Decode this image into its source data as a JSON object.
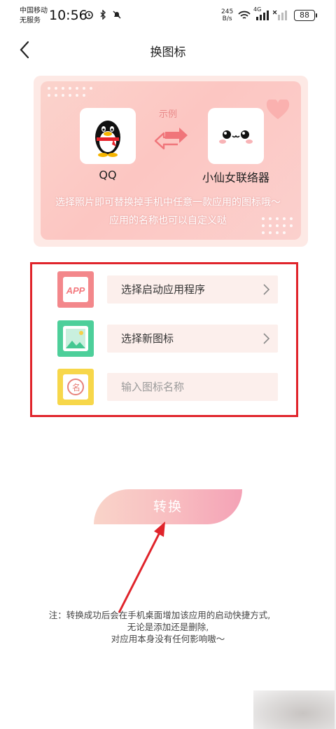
{
  "status_bar": {
    "carrier_1": "中国移动",
    "carrier_2": "无服务",
    "time": "10:56",
    "net_speed_value": "245",
    "net_speed_unit": "B/s",
    "network": "4G",
    "battery": "88"
  },
  "nav": {
    "title": "换图标",
    "back_icon": "chevron-left-icon"
  },
  "banner": {
    "example_label": "示例",
    "source_app_label": "QQ",
    "target_app_label": "小仙女联络器",
    "line_1": "选择照片即可替换掉手机中任意一款应用的图标哦～",
    "line_2": "应用的名称也可以自定义哒",
    "colors": {
      "text": "#ffffff",
      "example": "#e98a8a"
    }
  },
  "form": {
    "rows": [
      {
        "icon": "app-icon",
        "icon_text": "APP",
        "label": "选择启动应用程序",
        "has_chevron": true,
        "icon_color": "#f3878b"
      },
      {
        "icon": "image-icon",
        "label": "选择新图标",
        "has_chevron": true,
        "icon_color": "#4dcf9a"
      },
      {
        "icon": "name-icon",
        "icon_text": "名",
        "placeholder": "输入图标名称",
        "has_chevron": false,
        "icon_color": "#f7d74a"
      }
    ],
    "highlight_color": "#e0242b"
  },
  "convert_button": {
    "label": "转换"
  },
  "note": {
    "line_1": "注：转换成功后会在手机桌面增加该应用的启动快捷方式,",
    "line_2": "无论是添加还是删除,",
    "line_3": "对应用本身没有任何影响嗷～"
  }
}
